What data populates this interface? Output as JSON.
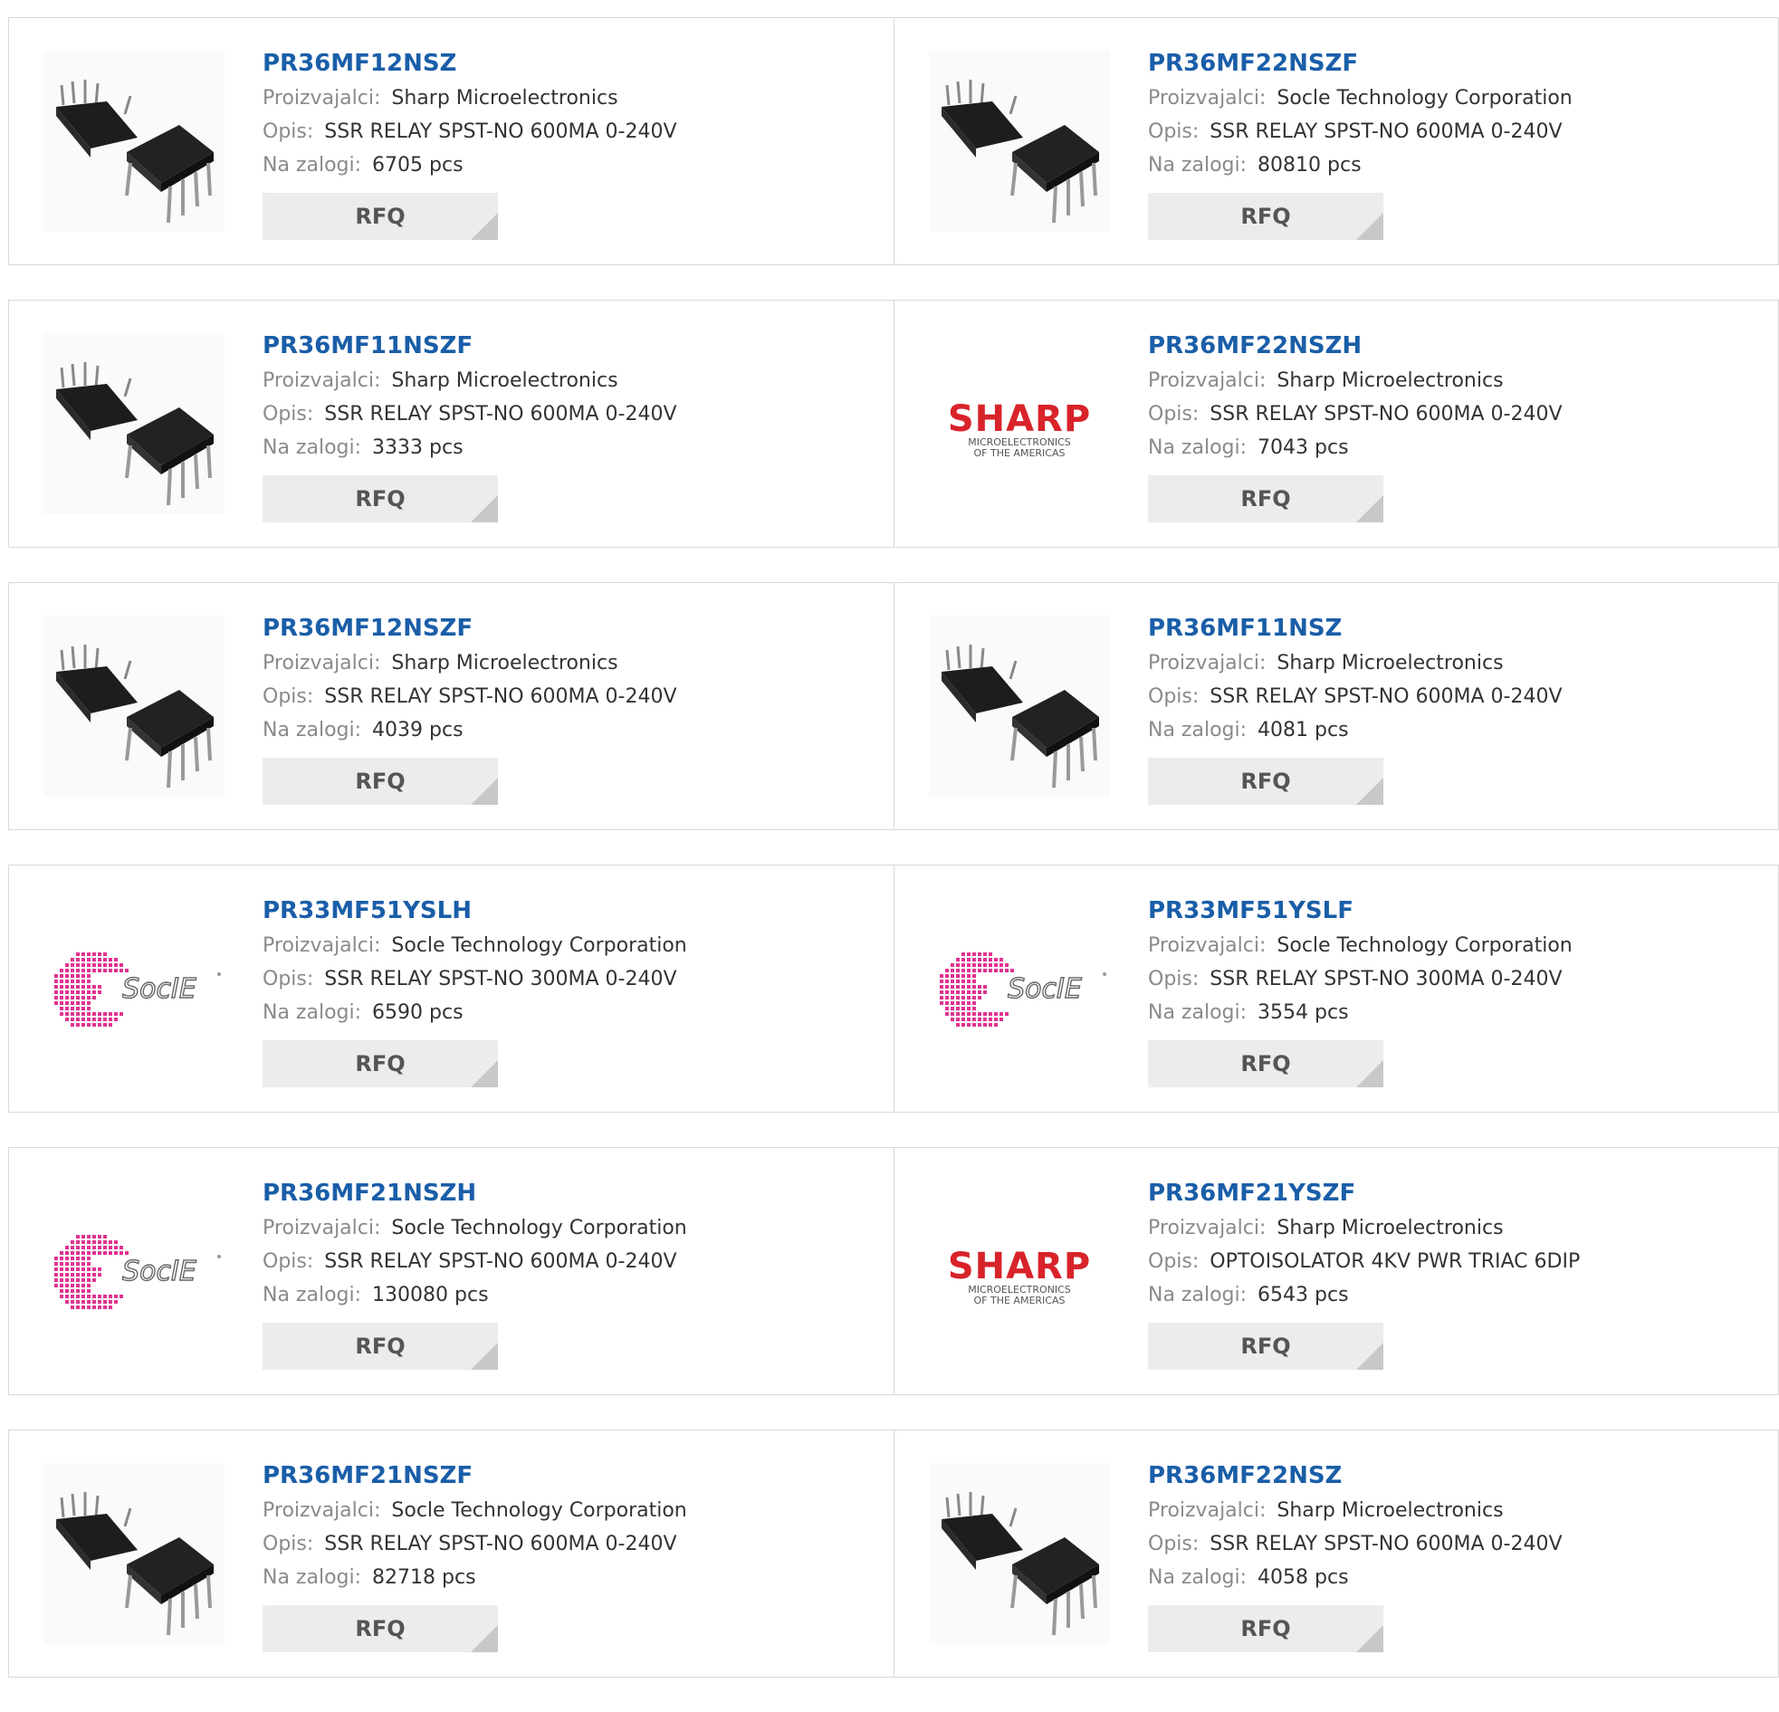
{
  "labels": {
    "manufacturer": "Proizvajalci:",
    "description": "Opis:",
    "stock": "Na zalogi:",
    "rfq": "RFQ"
  },
  "products": [
    {
      "pn": "PR36MF12NSZ",
      "mfr": "Sharp Microelectronics",
      "desc": "SSR RELAY SPST-NO 600MA 0-240V",
      "stock": "6705 pcs",
      "image": "dip-chip"
    },
    {
      "pn": "PR36MF22NSZF",
      "mfr": "Socle Technology Corporation",
      "desc": "SSR RELAY SPST-NO 600MA 0-240V",
      "stock": "80810 pcs",
      "image": "dip-chip"
    },
    {
      "pn": "PR36MF11NSZF",
      "mfr": "Sharp Microelectronics",
      "desc": "SSR RELAY SPST-NO 600MA 0-240V",
      "stock": "3333 pcs",
      "image": "dip-chip"
    },
    {
      "pn": "PR36MF22NSZH",
      "mfr": "Sharp Microelectronics",
      "desc": "SSR RELAY SPST-NO 600MA 0-240V",
      "stock": "7043 pcs",
      "image": "sharp-logo"
    },
    {
      "pn": "PR36MF12NSZF",
      "mfr": "Sharp Microelectronics",
      "desc": "SSR RELAY SPST-NO 600MA 0-240V",
      "stock": "4039 pcs",
      "image": "dip-chip"
    },
    {
      "pn": "PR36MF11NSZ",
      "mfr": "Sharp Microelectronics",
      "desc": "SSR RELAY SPST-NO 600MA 0-240V",
      "stock": "4081 pcs",
      "image": "dip-chip"
    },
    {
      "pn": "PR33MF51YSLH",
      "mfr": "Socle Technology Corporation",
      "desc": "SSR RELAY SPST-NO 300MA 0-240V",
      "stock": "6590 pcs",
      "image": "socle-logo"
    },
    {
      "pn": "PR33MF51YSLF",
      "mfr": "Socle Technology Corporation",
      "desc": "SSR RELAY SPST-NO 300MA 0-240V",
      "stock": "3554 pcs",
      "image": "socle-logo"
    },
    {
      "pn": "PR36MF21NSZH",
      "mfr": "Socle Technology Corporation",
      "desc": "SSR RELAY SPST-NO 600MA 0-240V",
      "stock": "130080 pcs",
      "image": "socle-logo"
    },
    {
      "pn": "PR36MF21YSZF",
      "mfr": "Sharp Microelectronics",
      "desc": "OPTOISOLATOR 4KV PWR TRIAC 6DIP",
      "stock": "6543 pcs",
      "image": "sharp-logo"
    },
    {
      "pn": "PR36MF21NSZF",
      "mfr": "Socle Technology Corporation",
      "desc": "SSR RELAY SPST-NO 600MA 0-240V",
      "stock": "82718 pcs",
      "image": "dip-chip"
    },
    {
      "pn": "PR36MF22NSZ",
      "mfr": "Sharp Microelectronics",
      "desc": "SSR RELAY SPST-NO 600MA 0-240V",
      "stock": "4058 pcs",
      "image": "dip-chip"
    }
  ],
  "logo_text": {
    "sharp": "SHARP",
    "sharp_sub1": "MICROELECTRONICS",
    "sharp_sub2": "OF THE AMERICAS",
    "socle": "SocIE"
  },
  "colors": {
    "link": "#1a5ea8",
    "sharp_red": "#d8232a",
    "socle_pink": "#e0338f",
    "button_bg": "#ececec"
  }
}
